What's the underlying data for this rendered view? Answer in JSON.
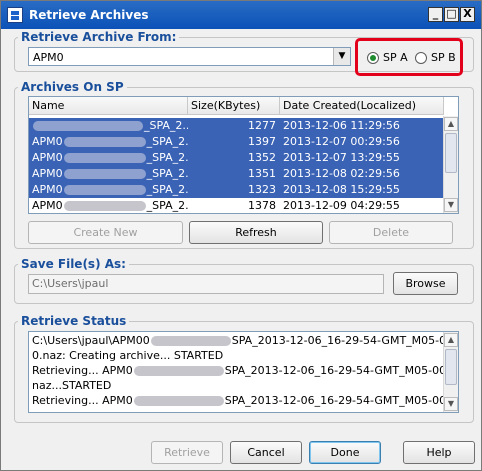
{
  "window": {
    "title": "Retrieve Archives",
    "controls": {
      "minimize": "_",
      "maximize": "□",
      "close": "X"
    }
  },
  "retrieve_from": {
    "group_label": "Retrieve Archive From:",
    "selected": "APM0",
    "options": [
      {
        "label": "SP A",
        "checked": true
      },
      {
        "label": "SP B",
        "checked": false
      }
    ]
  },
  "archives": {
    "group_label": "Archives On SP",
    "columns": [
      "Name",
      "Size(KBytes)",
      "Date Created(Localized)"
    ],
    "rows": [
      {
        "name_prefix": "",
        "name_suffix": "_SPA_2...",
        "size": "1277",
        "date": "2013-12-06 11:29:56",
        "selected": true
      },
      {
        "name_prefix": "APM0",
        "name_suffix": "_SPA_2...",
        "size": "1397",
        "date": "2013-12-07 00:29:56",
        "selected": true
      },
      {
        "name_prefix": "APM0",
        "name_suffix": "_SPA_2...",
        "size": "1352",
        "date": "2013-12-07 13:29:55",
        "selected": true
      },
      {
        "name_prefix": "APM0",
        "name_suffix": "_SPA_2...",
        "size": "1351",
        "date": "2013-12-08 02:29:56",
        "selected": true
      },
      {
        "name_prefix": "APM0",
        "name_suffix": "_SPA_2...",
        "size": "1323",
        "date": "2013-12-08 15:29:55",
        "selected": true
      },
      {
        "name_prefix": "APM0",
        "name_suffix": "_SPA_2...",
        "size": "1378",
        "date": "2013-12-09 04:29:55",
        "selected": false
      }
    ],
    "buttons": {
      "create_new": "Create New",
      "refresh": "Refresh",
      "delete": "Delete"
    }
  },
  "save_files": {
    "group_label": "Save File(s) As:",
    "path": "C:\\Users\\jpaul",
    "browse": "Browse"
  },
  "status": {
    "group_label": "Retrieve Status",
    "lines": [
      {
        "pre": "C:\\Users\\jpaul\\APM00",
        "post": "SPA_2013-12-06_16-29-54-GMT_M05-0"
      },
      {
        "pre": "0.naz: Creating archive...  STARTED",
        "post": ""
      },
      {
        "pre": "Retrieving...  APM0",
        "post": "SPA_2013-12-06_16-29-54-GMT_M05-00."
      },
      {
        "pre": "naz...STARTED",
        "post": ""
      },
      {
        "pre": "Retrieving...  APM0",
        "post": "SPA_2013-12-06_16-29-54-GMT_M05-00"
      }
    ]
  },
  "footer": {
    "retrieve": "Retrieve",
    "cancel": "Cancel",
    "done": "Done",
    "help": "Help"
  },
  "colors": {
    "title_bar": "#0b52b8",
    "selection": "#3b63b5",
    "group_label": "#1a4f9c",
    "highlight": "#e3001b"
  }
}
